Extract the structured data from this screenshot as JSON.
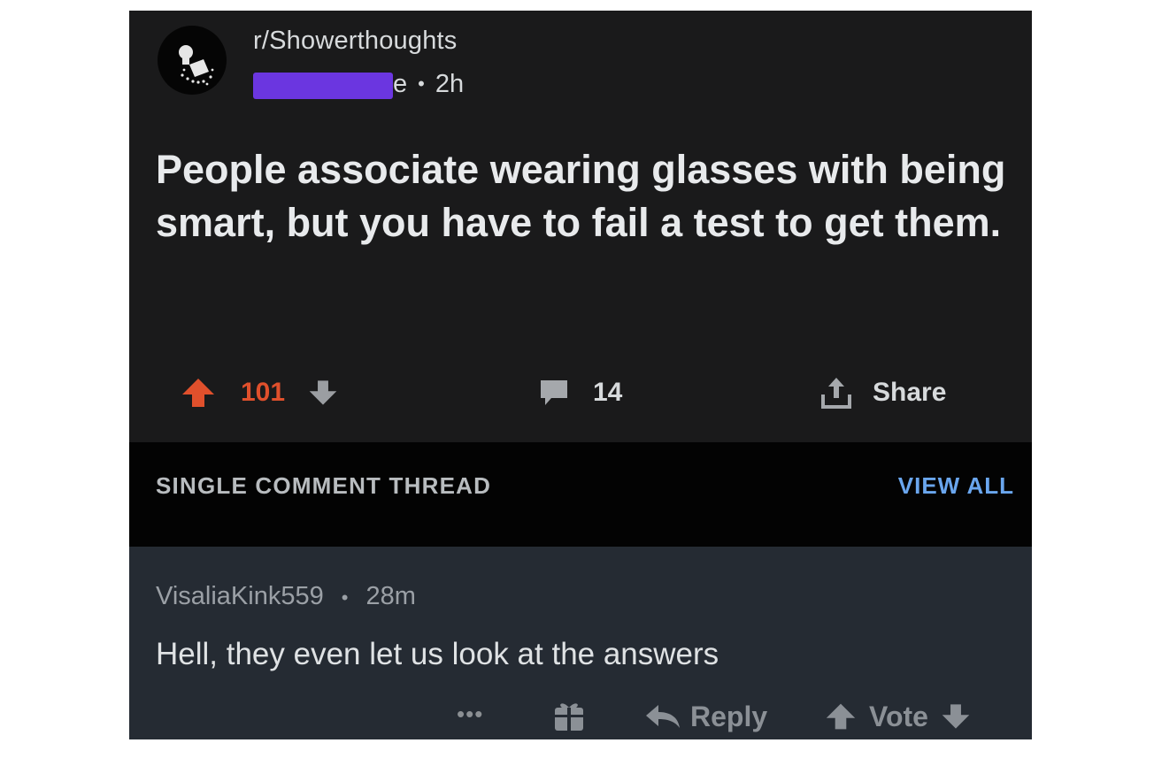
{
  "post": {
    "subreddit": "r/Showerthoughts",
    "author_visible_tail": "e",
    "age": "2h",
    "title": "People associate wearing glasses with being smart, but you have to fail a test to get them.",
    "score": "101",
    "comment_count": "14",
    "share_label": "Share"
  },
  "thread": {
    "label": "SINGLE COMMENT THREAD",
    "view_all_label": "VIEW ALL"
  },
  "comment": {
    "author": "VisaliaKink559",
    "age": "28m",
    "body": "Hell, they even let us look at the answers",
    "more_label": "•••",
    "reply_label": "Reply",
    "vote_label": "Vote"
  },
  "colors": {
    "upvote_active": "#e0502c",
    "link_blue": "#6aa6ee",
    "redaction": "#6b36e0",
    "post_bg": "#1a1a1b",
    "comment_bg": "#252b33"
  },
  "icons": [
    "subreddit-shower-icon",
    "upvote-icon",
    "downvote-icon",
    "comment-bubble-icon",
    "share-icon",
    "gift-icon",
    "reply-arrow-icon"
  ]
}
